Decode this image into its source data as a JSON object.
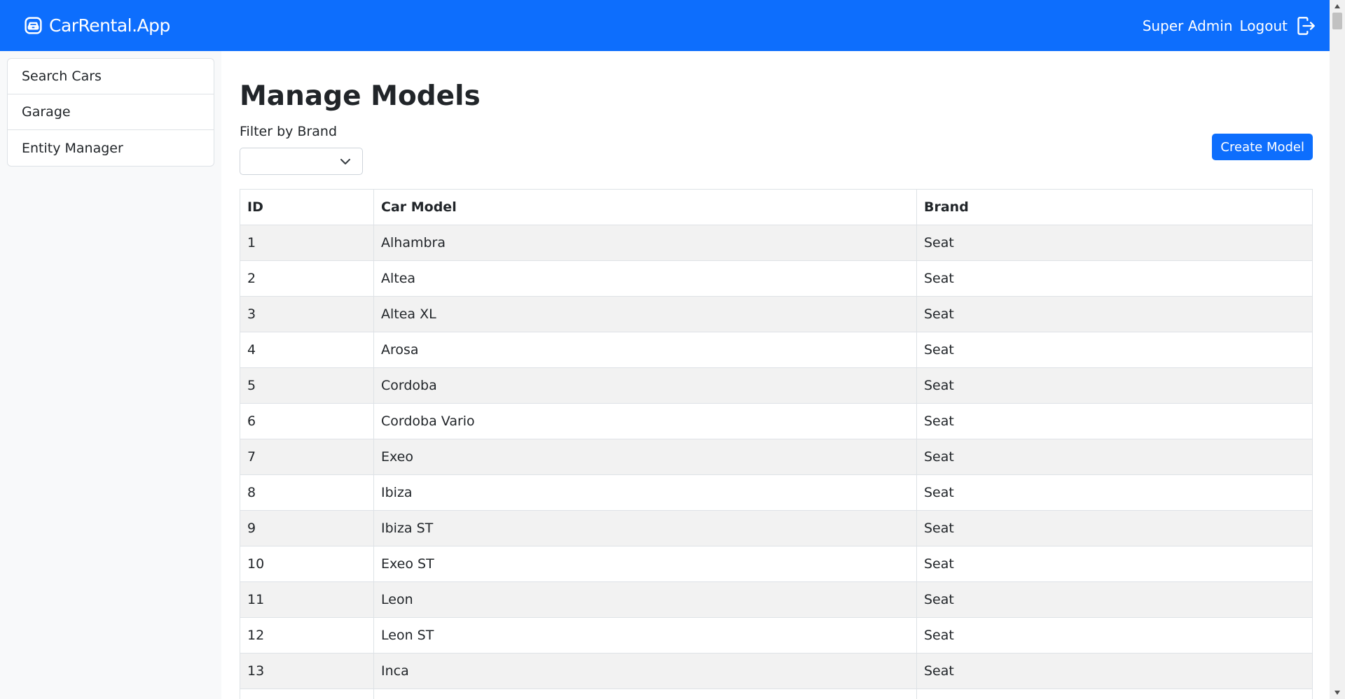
{
  "navbar": {
    "brand": "CarRental.App",
    "user": "Super Admin",
    "logout": "Logout"
  },
  "sidebar": {
    "items": [
      {
        "label": "Search Cars"
      },
      {
        "label": "Garage"
      },
      {
        "label": "Entity Manager"
      }
    ]
  },
  "main": {
    "title": "Manage Models",
    "filter_label": "Filter by Brand",
    "filter_value": "",
    "create_button": "Create Model"
  },
  "table": {
    "headers": [
      "ID",
      "Car Model",
      "Brand"
    ],
    "rows": [
      [
        "1",
        "Alhambra",
        "Seat"
      ],
      [
        "2",
        "Altea",
        "Seat"
      ],
      [
        "3",
        "Altea XL",
        "Seat"
      ],
      [
        "4",
        "Arosa",
        "Seat"
      ],
      [
        "5",
        "Cordoba",
        "Seat"
      ],
      [
        "6",
        "Cordoba Vario",
        "Seat"
      ],
      [
        "7",
        "Exeo",
        "Seat"
      ],
      [
        "8",
        "Ibiza",
        "Seat"
      ],
      [
        "9",
        "Ibiza ST",
        "Seat"
      ],
      [
        "10",
        "Exeo ST",
        "Seat"
      ],
      [
        "11",
        "Leon",
        "Seat"
      ],
      [
        "12",
        "Leon ST",
        "Seat"
      ],
      [
        "13",
        "Inca",
        "Seat"
      ],
      [
        "",
        "",
        ""
      ]
    ]
  },
  "colors": {
    "primary": "#0d6efd",
    "sidebar_bg": "#f8f9fa",
    "stripe": "#f2f2f2",
    "border": "#dee2e6"
  },
  "icons": {
    "brand": "car-front-icon",
    "logout": "box-arrow-right-icon",
    "select": "chevron-down-icon"
  }
}
